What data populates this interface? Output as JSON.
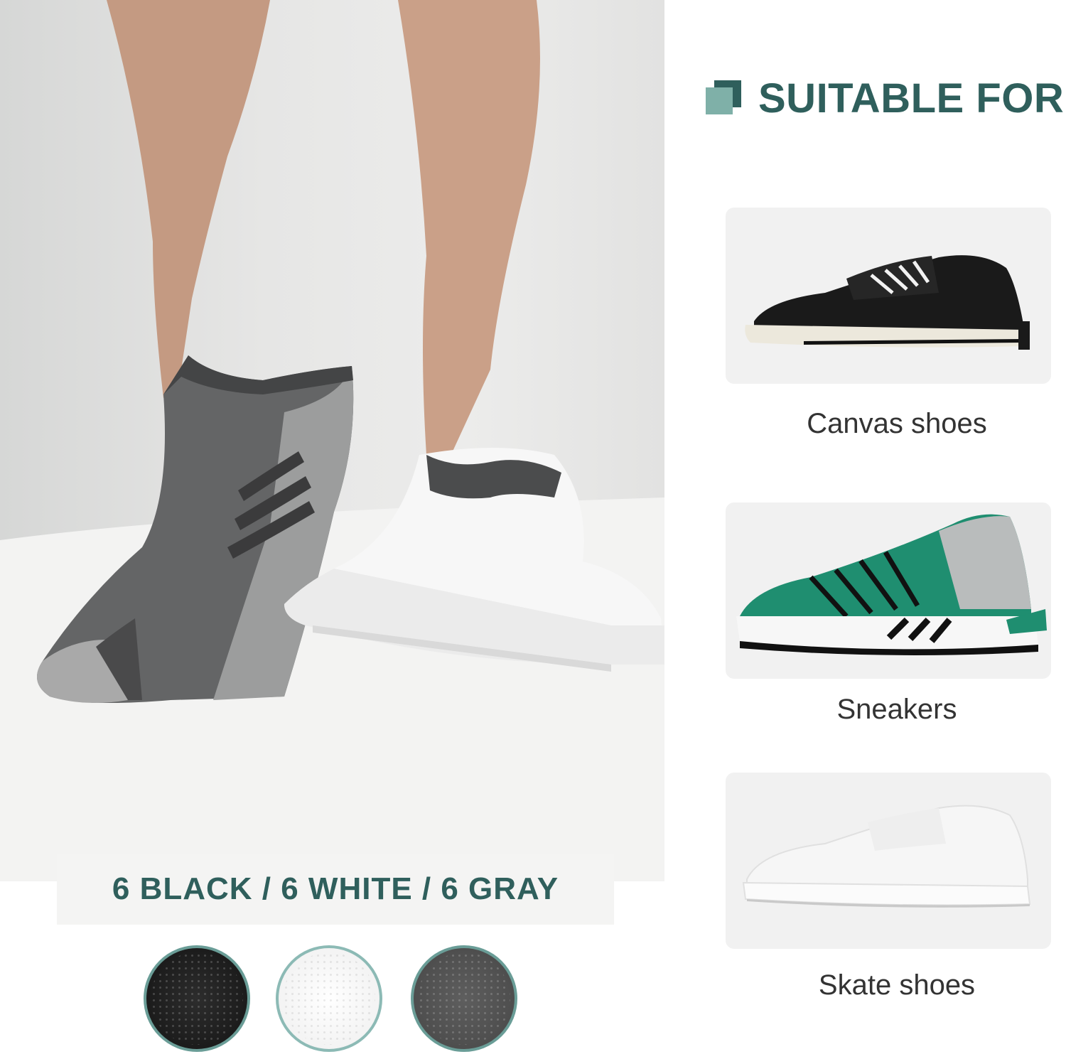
{
  "colors_caption": "6 BLACK / 6 WHITE / 6 GRAY",
  "swatches": [
    {
      "name": "black",
      "color": "#1c1c1c"
    },
    {
      "name": "white",
      "color": "#ffffff"
    },
    {
      "name": "gray",
      "color": "#505050"
    }
  ],
  "suitable": {
    "heading": "SUITABLE FOR",
    "items": [
      {
        "label": "Canvas shoes",
        "icon": "canvas-shoe-icon"
      },
      {
        "label": "Sneakers",
        "icon": "sneaker-icon"
      },
      {
        "label": "Skate shoes",
        "icon": "skate-shoe-icon"
      }
    ]
  },
  "accent_color": "#2f5f5c",
  "accent_light": "#7fb0a8"
}
